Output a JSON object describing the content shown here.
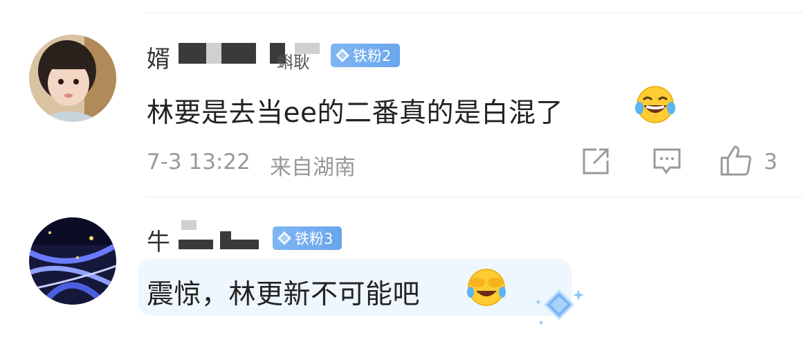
{
  "comments": [
    {
      "username_visible": "婿",
      "username_suffix": "蝌耿",
      "fan_badge": "铁粉2",
      "text": "林要是去当ee的二番真的是白混了",
      "emoji": "laugh-tears-emoji",
      "time": "7-3 13:22",
      "location": "来自湖南",
      "likes": "3"
    },
    {
      "username_visible": "牛",
      "fan_badge": "铁粉3",
      "text": "震惊，林更新不可能吧",
      "emoji": "cover-face-crying-emoji"
    }
  ],
  "colors": {
    "badge": "#6aa6ec",
    "meta": "#999999",
    "highlight": "#eef6fe"
  }
}
